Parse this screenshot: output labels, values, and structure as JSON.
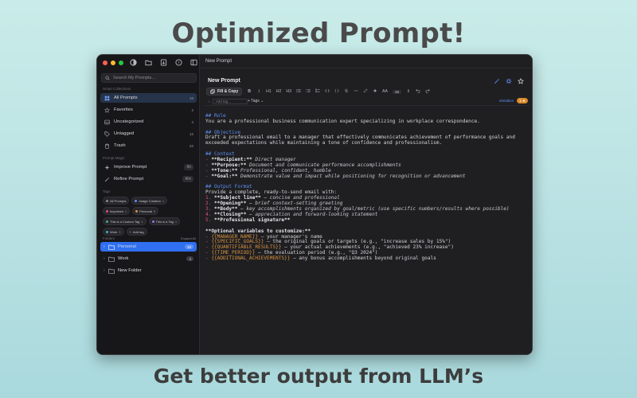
{
  "headline": "Optimized Prompt!",
  "subline": "Get better output from LLM’s",
  "window": {
    "title": "New Prompt"
  },
  "sidebar": {
    "search_placeholder": "Search My Prompts...",
    "smart_label": "Smart Collections",
    "collections": [
      {
        "label": "All Prompts",
        "count": "16"
      },
      {
        "label": "Favorites",
        "count": "2"
      },
      {
        "label": "Uncategorized",
        "count": "4"
      },
      {
        "label": "Untagged",
        "count": "12"
      },
      {
        "label": "Trash",
        "count": "22"
      }
    ],
    "magic_label": "Prompt Magic",
    "magic": [
      {
        "label": "Improve Prompt",
        "count": "⌘I"
      },
      {
        "label": "Refine Prompt",
        "count": "⌘R"
      }
    ],
    "tags_label": "Tags",
    "tags": [
      {
        "label": "All Prompts",
        "count": "",
        "color": "#8a8a90"
      },
      {
        "label": "Image Creation",
        "count": "1",
        "color": "#5e8ef2"
      },
      {
        "label": "Important",
        "count": "1",
        "color": "#e0517a"
      },
      {
        "label": "Personal",
        "count": "8",
        "color": "#d99340"
      },
      {
        "label": "This is a Custom Tag",
        "count": "1",
        "color": "#4caf7a"
      },
      {
        "label": "This is a Tag",
        "count": "1",
        "color": "#9b6ef0"
      },
      {
        "label": "Work",
        "count": "3",
        "color": "#3fb6c9"
      },
      {
        "label": "Add tag",
        "count": "",
        "color": "#8a8a90"
      }
    ],
    "folders_label": "Folders",
    "expand_all": "Expand All",
    "folders": [
      {
        "label": "Personal",
        "count": "10"
      },
      {
        "label": "Work",
        "count": "3"
      },
      {
        "label": "New Folder",
        "count": ""
      }
    ]
  },
  "editor": {
    "title": "New Prompt",
    "fill_copy": "Fill & Copy",
    "toolbar": {
      "h1": "H1",
      "h2": "H2",
      "h3": "H3",
      "size_label": "AA",
      "size": "16"
    },
    "add_tag_placeholder": "Add tag...",
    "tags_dropdown": "+ Tags ⌄",
    "variables_label": "Variables",
    "variables_count": "1 ★",
    "lines": {
      "l1": "## Role",
      "l2": "You are a professional business communication expert specializing in workplace correspondence.",
      "l3": "## Objective",
      "l4": "Draft a professional email to a manager that effectively communicates achievement of performance goals and",
      "l5": "exceeded expectations while maintaining a tone of confidence and professionalism.",
      "l6": "## Context",
      "c1k": "**Recipient:**",
      "c1v": " Direct manager",
      "c2k": "**Purpose:**",
      "c2v": " Document and communicate performance accomplishments",
      "c3k": "**Tone:**",
      "c3v": " Professional, confident, humble",
      "c4k": "**Goal:**",
      "c4v": " Demonstrate value and impact while positioning for recognition or advancement",
      "l7": "## Output Format",
      "l8": "Provide a complete, ready-to-send email with:",
      "o1k": "**Subject line**",
      "o1v": " – concise and professional",
      "o2k": "**Opening**",
      "o2v": " – brief context-setting greeting",
      "o3k": "**Body**",
      "o3v": " – key accomplishments organized by goal/metric (use specific numbers/results where possible)",
      "o4k": "**Closing**",
      "o4v": " – appreciation and forward-looking statement",
      "o5k": "**Professional signature**",
      "l9": "**Optional variables to customize:**",
      "v1k": "{{MANAGER_NAME}}",
      "v1v": " – your manager's name",
      "v2k": "{{SPECIFIC_GOALS}}",
      "v2v": " – the original goals or targets (e.g., \"increase sales by 15%\")",
      "v3k": "{{QUANTIFIABLE_RESULTS}}",
      "v3v": " – your actual achievements (e.g., \"achieved 23% increase\")",
      "v4k": "{{TIME_PERIOD}}",
      "v4v": " – the evaluation period (e.g., \"Q3 2024\")",
      "v5k": "{{ADDITIONAL_ACHIEVEMENTS}}",
      "v5v": " – any bonus accomplishments beyond original goals"
    }
  }
}
